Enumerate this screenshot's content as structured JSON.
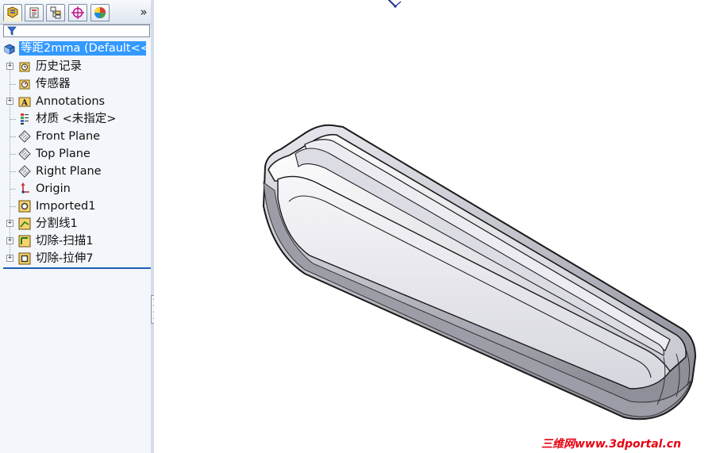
{
  "panel": {
    "tabs": [
      {
        "name": "featuremanager"
      },
      {
        "name": "propertymanager"
      },
      {
        "name": "configurationmanager"
      },
      {
        "name": "dimxpertmanager"
      },
      {
        "name": "displaymanager"
      }
    ],
    "expand_tabs_glyph": "»",
    "filter": {
      "icon": "filter-icon",
      "value": ""
    }
  },
  "tree": {
    "root": {
      "label": "等距2mma  (Default<<",
      "icon": "part-icon"
    },
    "items": [
      {
        "label": "历史记录",
        "icon": "history-icon",
        "expandable": true
      },
      {
        "label": "传感器",
        "icon": "sensor-icon",
        "expandable": false
      },
      {
        "label": "Annotations",
        "icon": "annotations-icon",
        "expandable": true
      },
      {
        "label": "材质 <未指定>",
        "icon": "material-icon",
        "expandable": false
      },
      {
        "label": "Front Plane",
        "icon": "plane-icon",
        "expandable": false
      },
      {
        "label": "Top Plane",
        "icon": "plane-icon",
        "expandable": false
      },
      {
        "label": "Right Plane",
        "icon": "plane-icon",
        "expandable": false
      },
      {
        "label": "Origin",
        "icon": "origin-icon",
        "expandable": false
      },
      {
        "label": "Imported1",
        "icon": "imported-icon",
        "expandable": false
      },
      {
        "label": "分割线1",
        "icon": "split-line-icon",
        "expandable": true
      },
      {
        "label": "切除-扫描1",
        "icon": "cut-sweep-icon",
        "expandable": true
      },
      {
        "label": "切除-拉伸7",
        "icon": "cut-extrude-icon",
        "expandable": true
      }
    ]
  },
  "watermark": "三维网www.3dportal.cn",
  "colors": {
    "selection": "#3399ff",
    "panel_bg": "#f3f6fa",
    "tree_end": "#1d5fb2",
    "watermark": "#e60012"
  }
}
